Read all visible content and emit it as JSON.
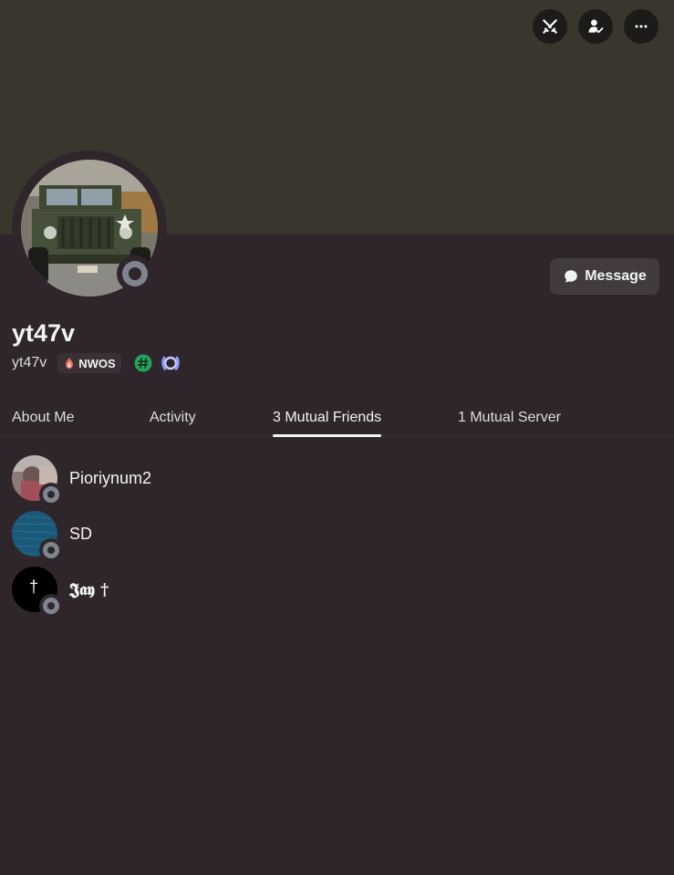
{
  "profile": {
    "display_name": "yt47v",
    "username": "yt47v",
    "guild_tag": "NWOS",
    "banner_color": "#39372d",
    "status": "offline"
  },
  "actions": {
    "icons": [
      "swords-icon",
      "friend-check-icon",
      "more-icon"
    ],
    "message_label": "Message"
  },
  "badges": [
    "hashtag-badge-icon",
    "laurel-badge-icon"
  ],
  "tabs": [
    {
      "label": "About Me"
    },
    {
      "label": "Activity"
    },
    {
      "label": "3 Mutual Friends",
      "active": true
    },
    {
      "label": "1 Mutual Server"
    }
  ],
  "friends": [
    {
      "name": "Pioriynum2",
      "status": "offline"
    },
    {
      "name": "SD",
      "status": "offline"
    },
    {
      "name": "𝕵𝖆𝖞 †",
      "avatar_glyph": "†",
      "status": "offline"
    }
  ],
  "colors": {
    "background": "#2f262b",
    "offline": "#80848e",
    "hashtag_badge": "#23a55a",
    "laurel_badge": "#8f9cff"
  }
}
